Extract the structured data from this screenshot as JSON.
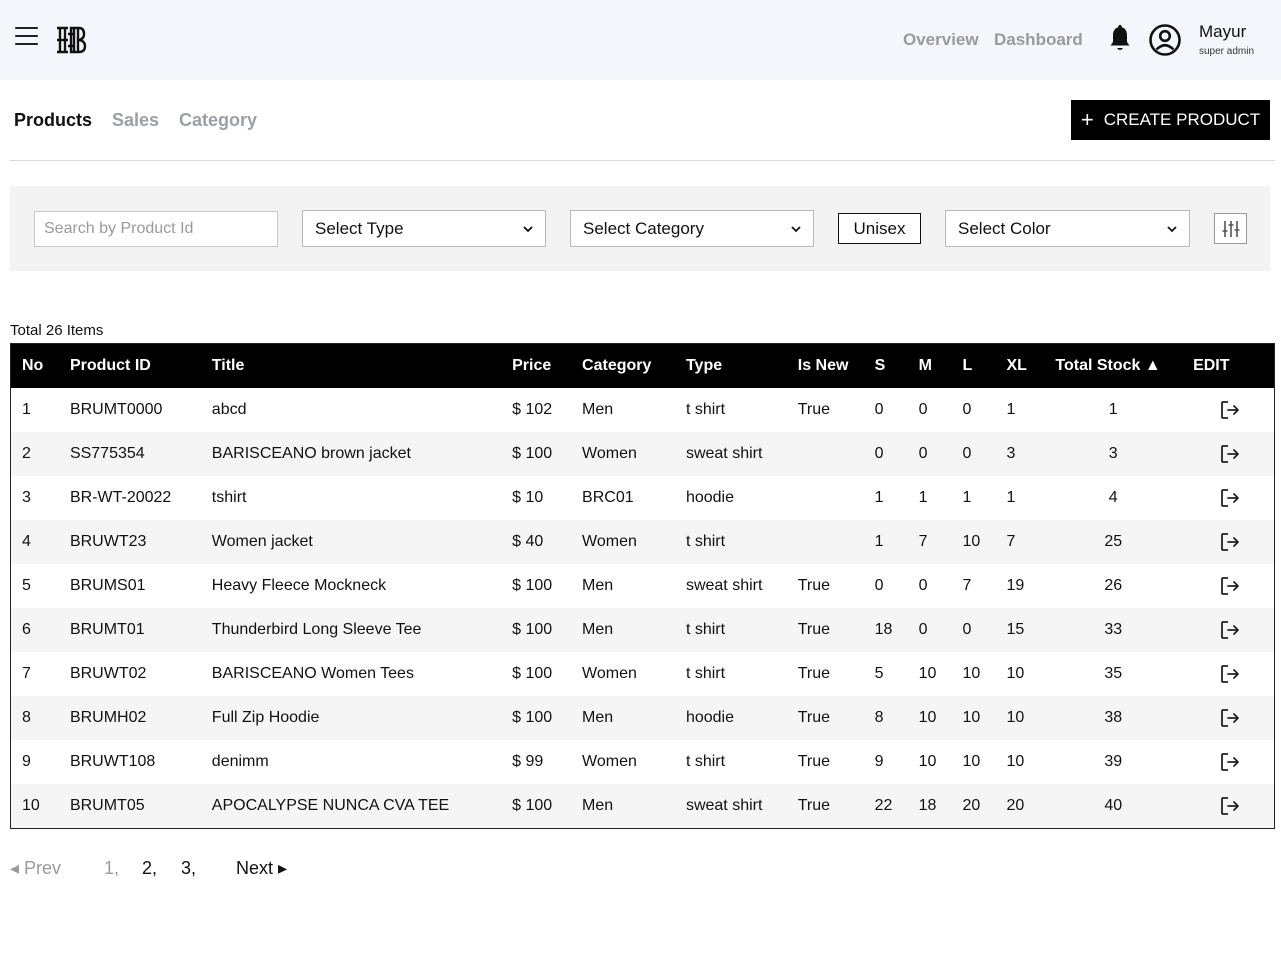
{
  "header": {
    "nav": [
      "Overview",
      "Dashboard"
    ],
    "user": {
      "name": "Mayur",
      "role": "super admin"
    }
  },
  "tabs": [
    {
      "label": "Products",
      "active": true
    },
    {
      "label": "Sales",
      "active": false
    },
    {
      "label": "Category",
      "active": false
    }
  ],
  "create_button": {
    "icon": "plus-icon",
    "label": "CREATE PRODUCT"
  },
  "filters": {
    "search_placeholder": "Search by Product Id",
    "type": "Select Type",
    "category": "Select Category",
    "unisex": "Unisex",
    "color": "Select Color"
  },
  "table": {
    "total_label": "Total 26 Items",
    "columns": [
      "No",
      "Product ID",
      "Title",
      "Price",
      "Category",
      "Type",
      "Is New",
      "S",
      "M",
      "L",
      "XL",
      "Total Stock ▲",
      "EDIT"
    ],
    "rows": [
      [
        "1",
        "BRUMT0000",
        "abcd",
        "$ 102",
        "Men",
        "t shirt",
        "True",
        "0",
        "0",
        "0",
        "1",
        "1"
      ],
      [
        "2",
        "SS775354",
        "BARISCEANO brown jacket",
        "$ 100",
        "Women",
        "sweat shirt",
        "",
        "0",
        "0",
        "0",
        "3",
        "3"
      ],
      [
        "3",
        "BR-WT-20022",
        "tshirt",
        "$ 10",
        "BRC01",
        "hoodie",
        "",
        "1",
        "1",
        "1",
        "1",
        "4"
      ],
      [
        "4",
        "BRUWT23",
        "Women jacket",
        "$ 40",
        "Women",
        "t shirt",
        "",
        "1",
        "7",
        "10",
        "7",
        "25"
      ],
      [
        "5",
        "BRUMS01",
        "Heavy Fleece Mockneck",
        "$ 100",
        "Men",
        "sweat shirt",
        "True",
        "0",
        "0",
        "7",
        "19",
        "26"
      ],
      [
        "6",
        "BRUMT01",
        "Thunderbird Long Sleeve Tee",
        "$ 100",
        "Men",
        "t shirt",
        "True",
        "18",
        "0",
        "0",
        "15",
        "33"
      ],
      [
        "7",
        "BRUWT02",
        "BARISCEANO Women Tees",
        "$ 100",
        "Women",
        "t shirt",
        "True",
        "5",
        "10",
        "10",
        "10",
        "35"
      ],
      [
        "8",
        "BRUMH02",
        "Full Zip Hoodie",
        "$ 100",
        "Men",
        "hoodie",
        "True",
        "8",
        "10",
        "10",
        "10",
        "38"
      ],
      [
        "9",
        "BRUWT108",
        "denimm",
        "$ 99",
        "Women",
        "t shirt",
        "True",
        "9",
        "10",
        "10",
        "10",
        "39"
      ],
      [
        "10",
        "BRUMT05",
        "APOCALYPSE NUNCA CVA TEE",
        "$ 100",
        "Men",
        "sweat shirt",
        "True",
        "22",
        "18",
        "20",
        "20",
        "40"
      ]
    ]
  },
  "pagination": {
    "prev": "◂ Prev",
    "pages": [
      "1,",
      "2,",
      "3,"
    ],
    "current": "1,",
    "next": "Next ▸"
  }
}
